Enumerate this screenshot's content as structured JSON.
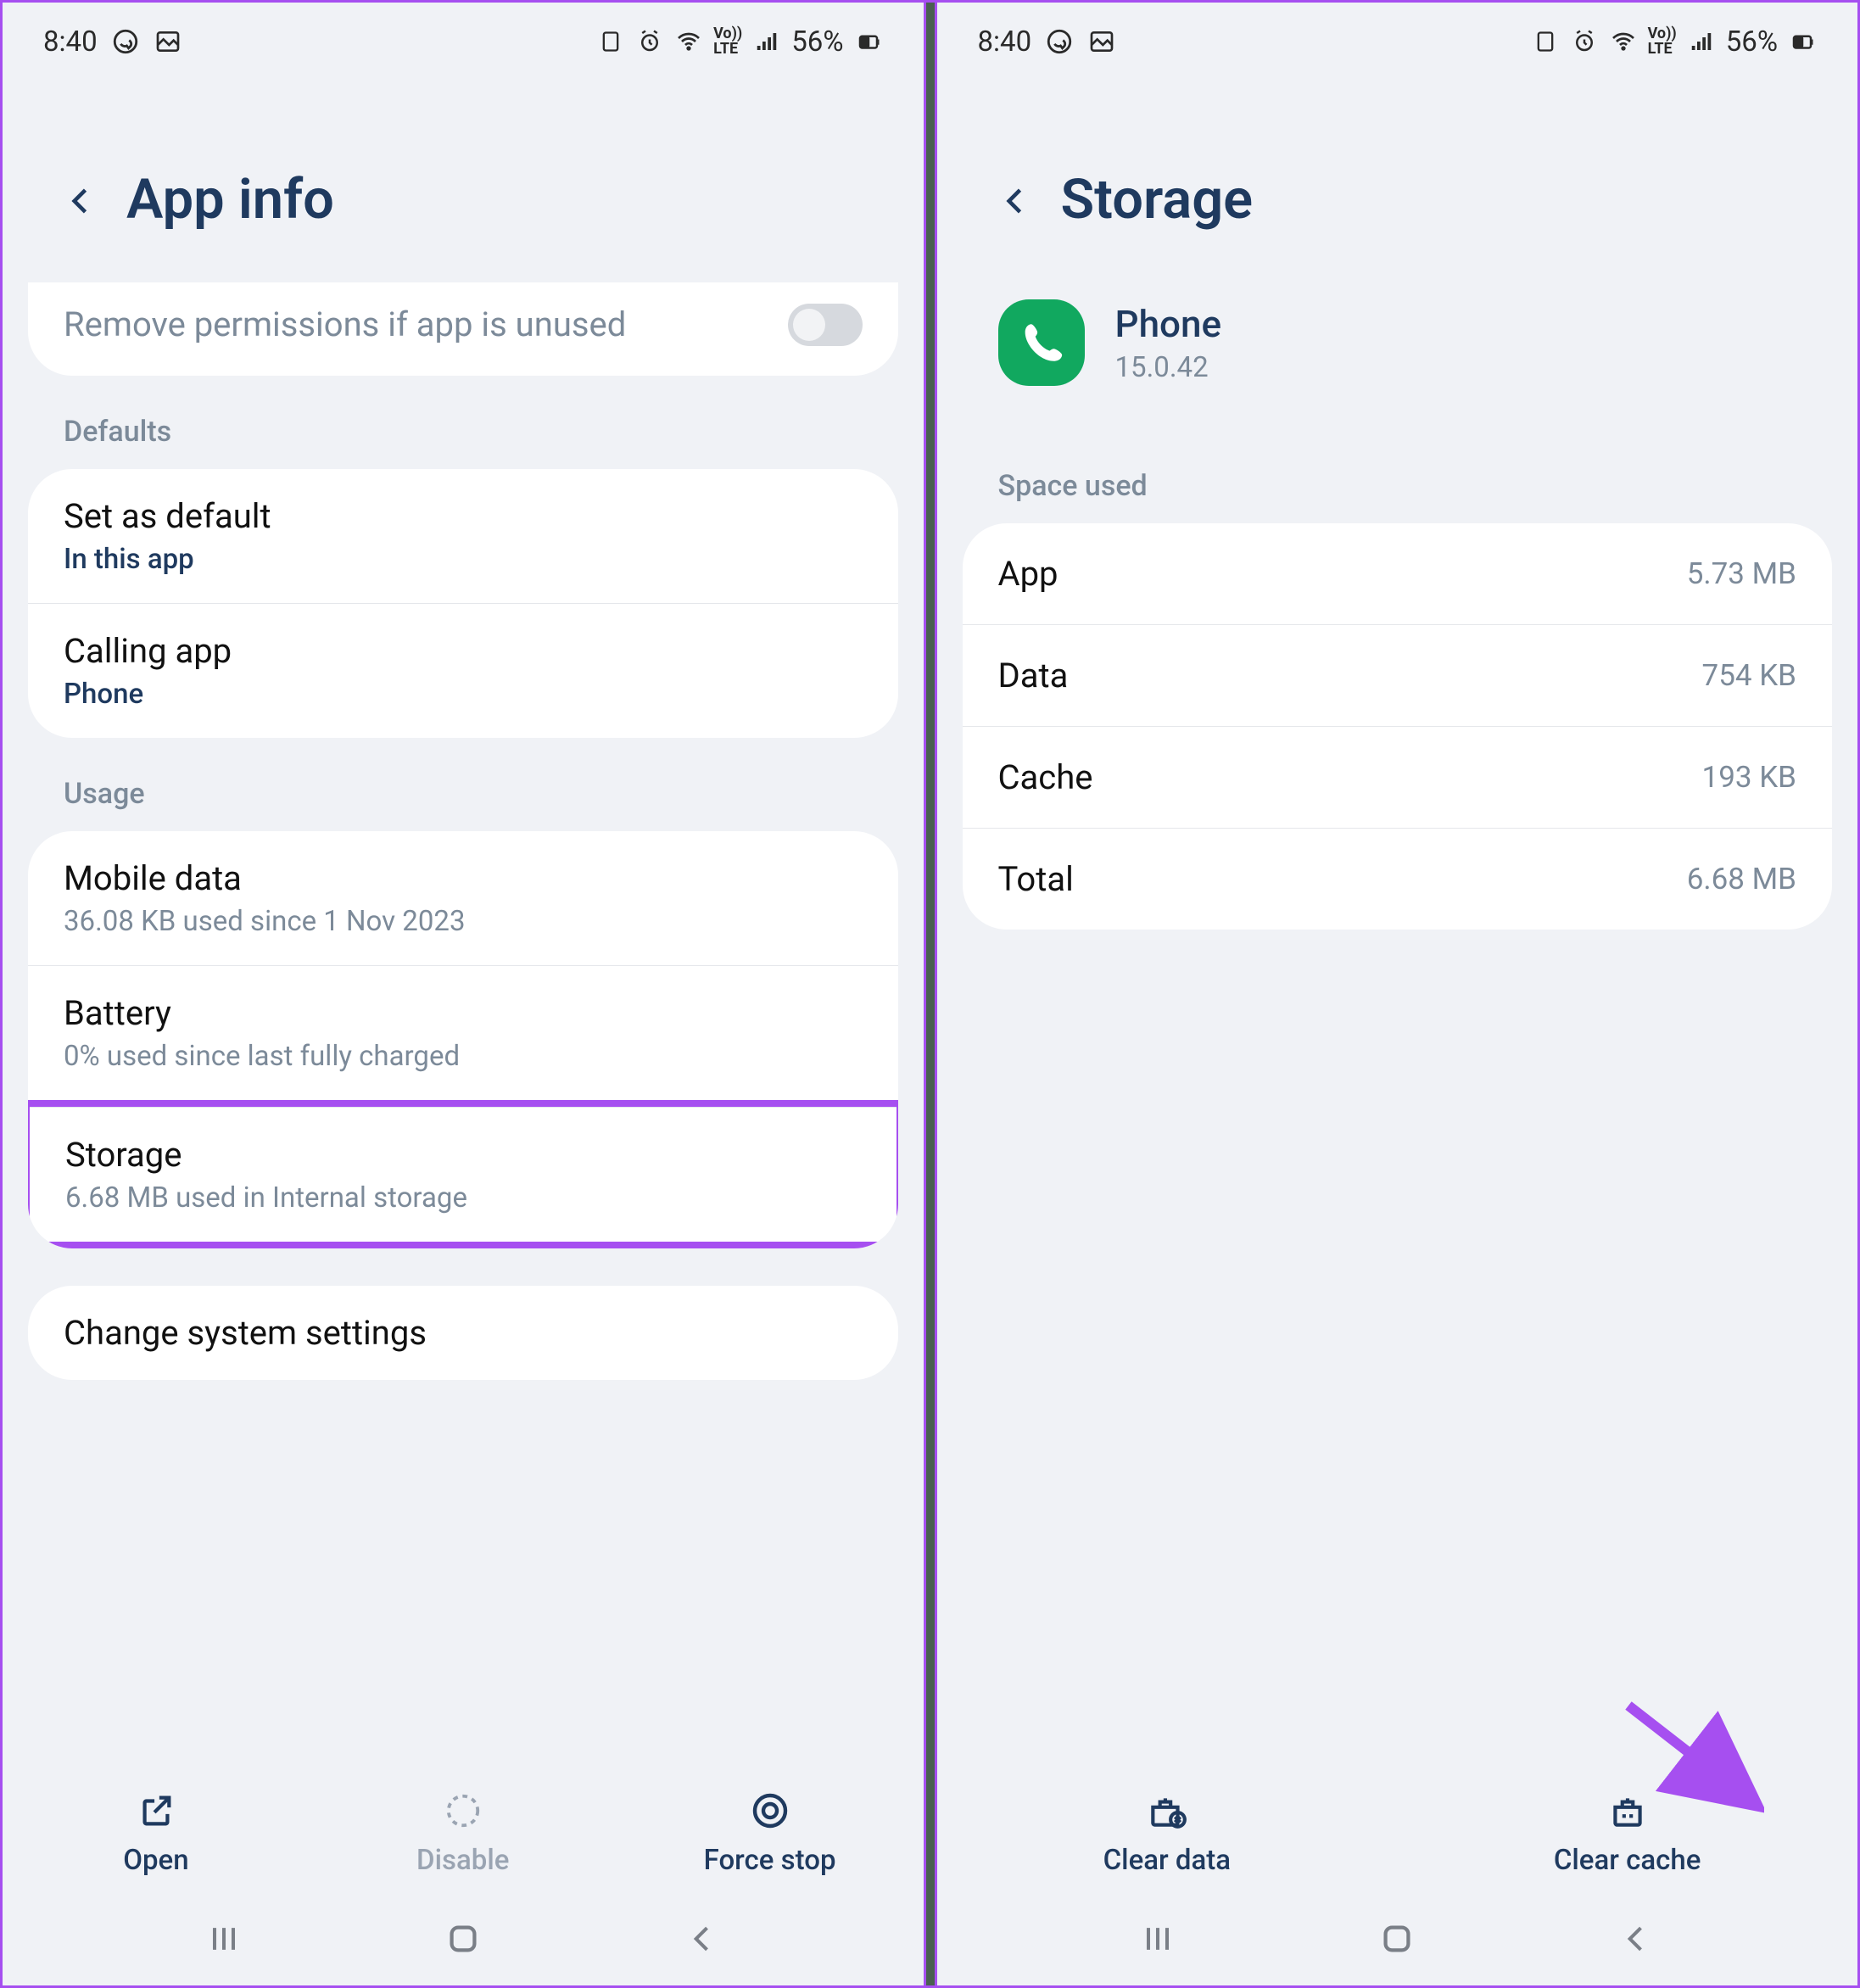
{
  "status": {
    "time": "8:40",
    "battery_pct": "56%"
  },
  "left": {
    "title": "App info",
    "permission_text": "Remove permissions if app is unused",
    "sections": {
      "defaults": {
        "label": "Defaults",
        "set_default": {
          "title": "Set as default",
          "sub": "In this app"
        },
        "calling_app": {
          "title": "Calling app",
          "sub": "Phone"
        }
      },
      "usage": {
        "label": "Usage",
        "mobile_data": {
          "title": "Mobile data",
          "sub": "36.08 KB used since 1 Nov 2023"
        },
        "battery": {
          "title": "Battery",
          "sub": "0% used since last fully charged"
        },
        "storage": {
          "title": "Storage",
          "sub": "6.68 MB used in Internal storage"
        }
      },
      "change_settings": "Change system settings"
    },
    "actions": {
      "open": "Open",
      "disable": "Disable",
      "force_stop": "Force stop"
    }
  },
  "right": {
    "title": "Storage",
    "app": {
      "name": "Phone",
      "version": "15.0.42"
    },
    "space_used_label": "Space used",
    "rows": {
      "app": {
        "label": "App",
        "value": "5.73 MB"
      },
      "data": {
        "label": "Data",
        "value": "754 KB"
      },
      "cache": {
        "label": "Cache",
        "value": "193 KB"
      },
      "total": {
        "label": "Total",
        "value": "6.68 MB"
      }
    },
    "actions": {
      "clear_data": "Clear data",
      "clear_cache": "Clear cache"
    }
  }
}
